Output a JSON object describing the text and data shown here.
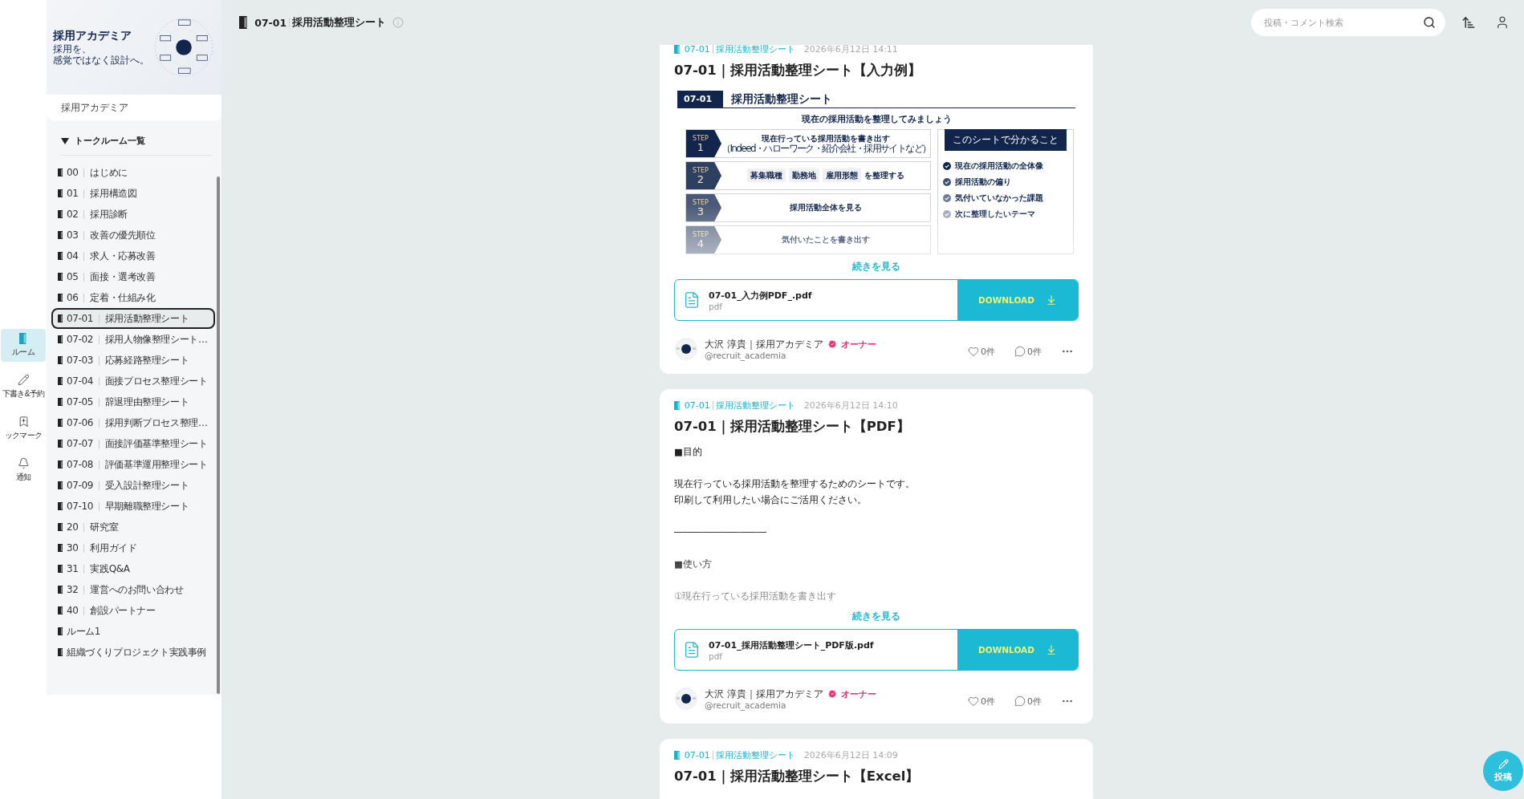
{
  "rail": [
    {
      "label": "ルーム",
      "kind": "room",
      "selected": true
    },
    {
      "label": "下書き&予約",
      "kind": "draft",
      "selected": false
    },
    {
      "label": "ックマーク",
      "kind": "bookmark",
      "selected": false
    },
    {
      "label": "通知",
      "kind": "notice",
      "selected": false
    }
  ],
  "sidebar": {
    "banner": {
      "title": "採用アカデミア",
      "tagline": [
        "採用を、",
        "感覚ではなく設計へ。"
      ]
    },
    "community": "採用アカデミア",
    "section": {
      "label": "トークルーム一覧",
      "expanded": true
    },
    "rooms": [
      {
        "code": "00",
        "name": "はじめに",
        "selected": false
      },
      {
        "code": "01",
        "name": "採用構造図",
        "selected": false
      },
      {
        "code": "02",
        "name": "採用診断",
        "selected": false
      },
      {
        "code": "03",
        "name": "改善の優先順位",
        "selected": false
      },
      {
        "code": "04",
        "name": "求人・応募改善",
        "selected": false
      },
      {
        "code": "05",
        "name": "面接・選考改善",
        "selected": false
      },
      {
        "code": "06",
        "name": "定着・仕組み化",
        "selected": false
      },
      {
        "code": "07-01",
        "name": "採用活動整理シート",
        "selected": true
      },
      {
        "code": "07-02",
        "name": "採用人物像整理シート…",
        "selected": false
      },
      {
        "code": "07-03",
        "name": "応募経路整理シート",
        "selected": false
      },
      {
        "code": "07-04",
        "name": "面接プロセス整理シート",
        "selected": false
      },
      {
        "code": "07-05",
        "name": "辞退理由整理シート",
        "selected": false
      },
      {
        "code": "07-06",
        "name": "採用判断プロセス整理…",
        "selected": false
      },
      {
        "code": "07-07",
        "name": "面接評価基準整理シート",
        "selected": false
      },
      {
        "code": "07-08",
        "name": "評価基準運用整理シート",
        "selected": false
      },
      {
        "code": "07-09",
        "name": "受入設計整理シート",
        "selected": false
      },
      {
        "code": "07-10",
        "name": "早期離職整理シート",
        "selected": false
      },
      {
        "code": "20",
        "name": "研究室",
        "selected": false
      },
      {
        "code": "30",
        "name": "利用ガイド",
        "selected": false
      },
      {
        "code": "31",
        "name": "実践Q&A",
        "selected": false
      },
      {
        "code": "32",
        "name": "運営へのお問い合わせ",
        "selected": false
      },
      {
        "code": "40",
        "name": "創設パートナー",
        "selected": false
      },
      {
        "name": "ルーム1",
        "selected": false
      },
      {
        "name": "組織づくりプロジェクト実践事例",
        "selected": false
      }
    ]
  },
  "header": {
    "code": "07-01",
    "name": "採用活動整理シート",
    "search": {
      "placeholder": "投稿・コメント検索"
    }
  },
  "posts": [
    {
      "room_code": "07-01",
      "room_name": "採用活動整理シート",
      "time": "2026年6月12日 14:11",
      "title": "07-01｜採用活動整理シート【入力例】",
      "preview": {
        "kind": "sheet",
        "badge": "07-01",
        "heading": "採用活動整理シート",
        "lead": "現在の採用活動を整理してみましょう",
        "steps": [
          {
            "label": "STEP",
            "number": "1",
            "text": "現在行っている採用活動を書き出す",
            "note": "（Indeed・ハローワーク・紹介会社・採用サイトなど）"
          },
          {
            "label": "STEP",
            "number": "2",
            "chips": [
              "募集職種",
              "勤務地",
              "雇用形態"
            ],
            "text": "を整理する"
          },
          {
            "label": "STEP",
            "number": "3",
            "text": "採用活動全体を見る"
          },
          {
            "label": "STEP",
            "number": "4",
            "text": "気付いたことを書き出す"
          }
        ],
        "box_title": "このシートで分かること",
        "checks": [
          "現在の採用活動の全体像",
          "採用活動の偏り",
          "気付いていなかった課題",
          "次に整理したいテーマ"
        ]
      },
      "more": "続きを見る",
      "file": {
        "name": "07-01_入力例PDF_.pdf",
        "type": "pdf"
      },
      "download": "DOWNLOAD",
      "author": {
        "name": "大沢 淳貴｜採用アカデミア",
        "role": "オーナー",
        "handle": "@recruit_academia"
      },
      "likes": "0件",
      "comments": "0件"
    },
    {
      "room_code": "07-01",
      "room_name": "採用活動整理シート",
      "time": "2026年6月12日 14:10",
      "title": "07-01｜採用活動整理シート【PDF】",
      "body": [
        {
          "kind": "heading",
          "text": "■目的"
        },
        {
          "kind": "line",
          "text": "現在行っている採用活動を整理するためのシートです。"
        },
        {
          "kind": "line",
          "text": "印刷して利用したい場合にご活用ください。"
        },
        {
          "kind": "rule",
          "text": "――――――――――"
        },
        {
          "kind": "heading",
          "text": "■使い方"
        },
        {
          "kind": "line",
          "text": "①現在行っている採用活動を書き出す"
        }
      ],
      "more": "続きを見る",
      "file": {
        "name": "07-01_採用活動整理シート_PDF版.pdf",
        "type": "pdf"
      },
      "download": "DOWNLOAD",
      "author": {
        "name": "大沢 淳貴｜採用アカデミア",
        "role": "オーナー",
        "handle": "@recruit_academia"
      },
      "likes": "0件",
      "comments": "0件"
    },
    {
      "room_code": "07-01",
      "room_name": "採用活動整理シート",
      "time": "2026年6月12日 14:09",
      "title": "07-01｜採用活動整理シート【Excel】"
    }
  ],
  "fab": {
    "label": "投稿"
  }
}
